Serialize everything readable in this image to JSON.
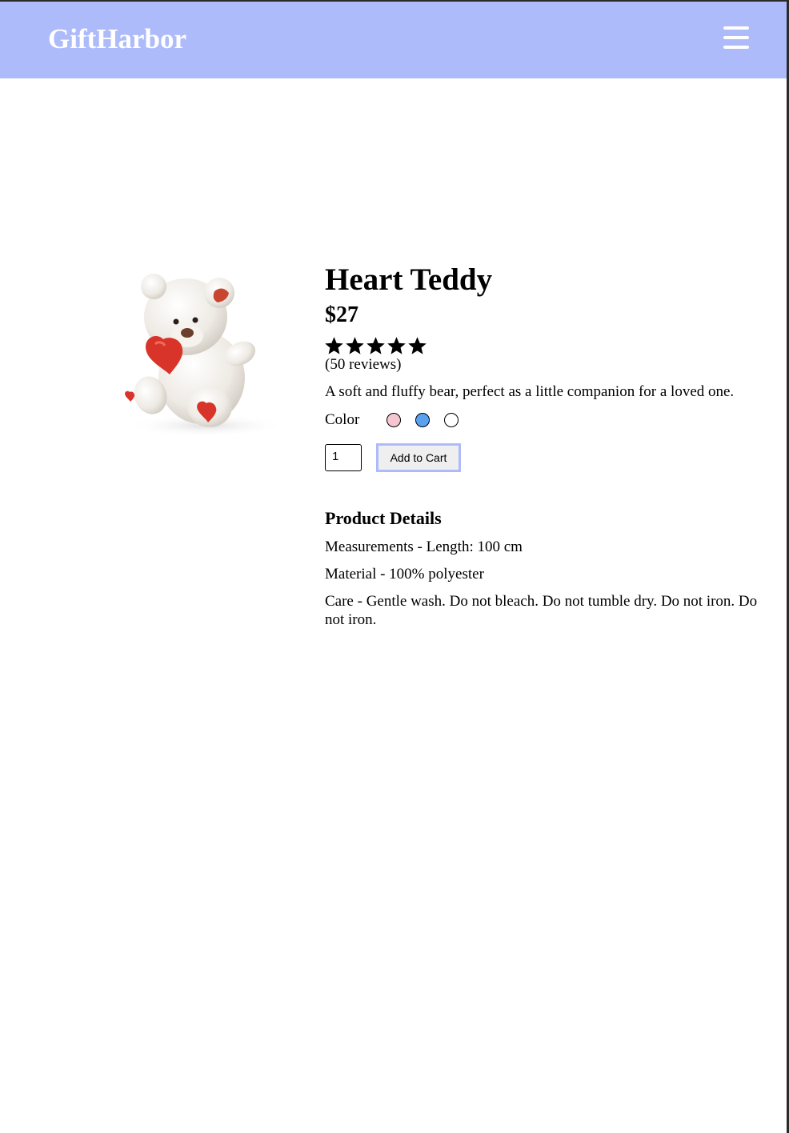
{
  "header": {
    "brand": "GiftHarbor",
    "menu_icon": "hamburger-menu-icon",
    "background_color": "#aebbfa"
  },
  "product": {
    "title": "Heart Teddy",
    "price": "$27",
    "rating": 5,
    "rating_max": 5,
    "reviews": "(50 reviews)",
    "description": "A soft and fluffy bear, perfect as a little companion for a loved one.",
    "color_label": "Color",
    "colors": [
      "#f6c6d0",
      "#5aa2f0",
      "#ffffff"
    ],
    "quantity": "1",
    "add_to_cart_label": "Add to Cart"
  },
  "details": {
    "heading": "Product Details",
    "measurements": "Measurements - Length: 100 cm",
    "material": "Material - 100% polyester",
    "care": "Care - Gentle wash. Do not bleach. Do not tumble dry. Do not iron. Do not iron."
  }
}
